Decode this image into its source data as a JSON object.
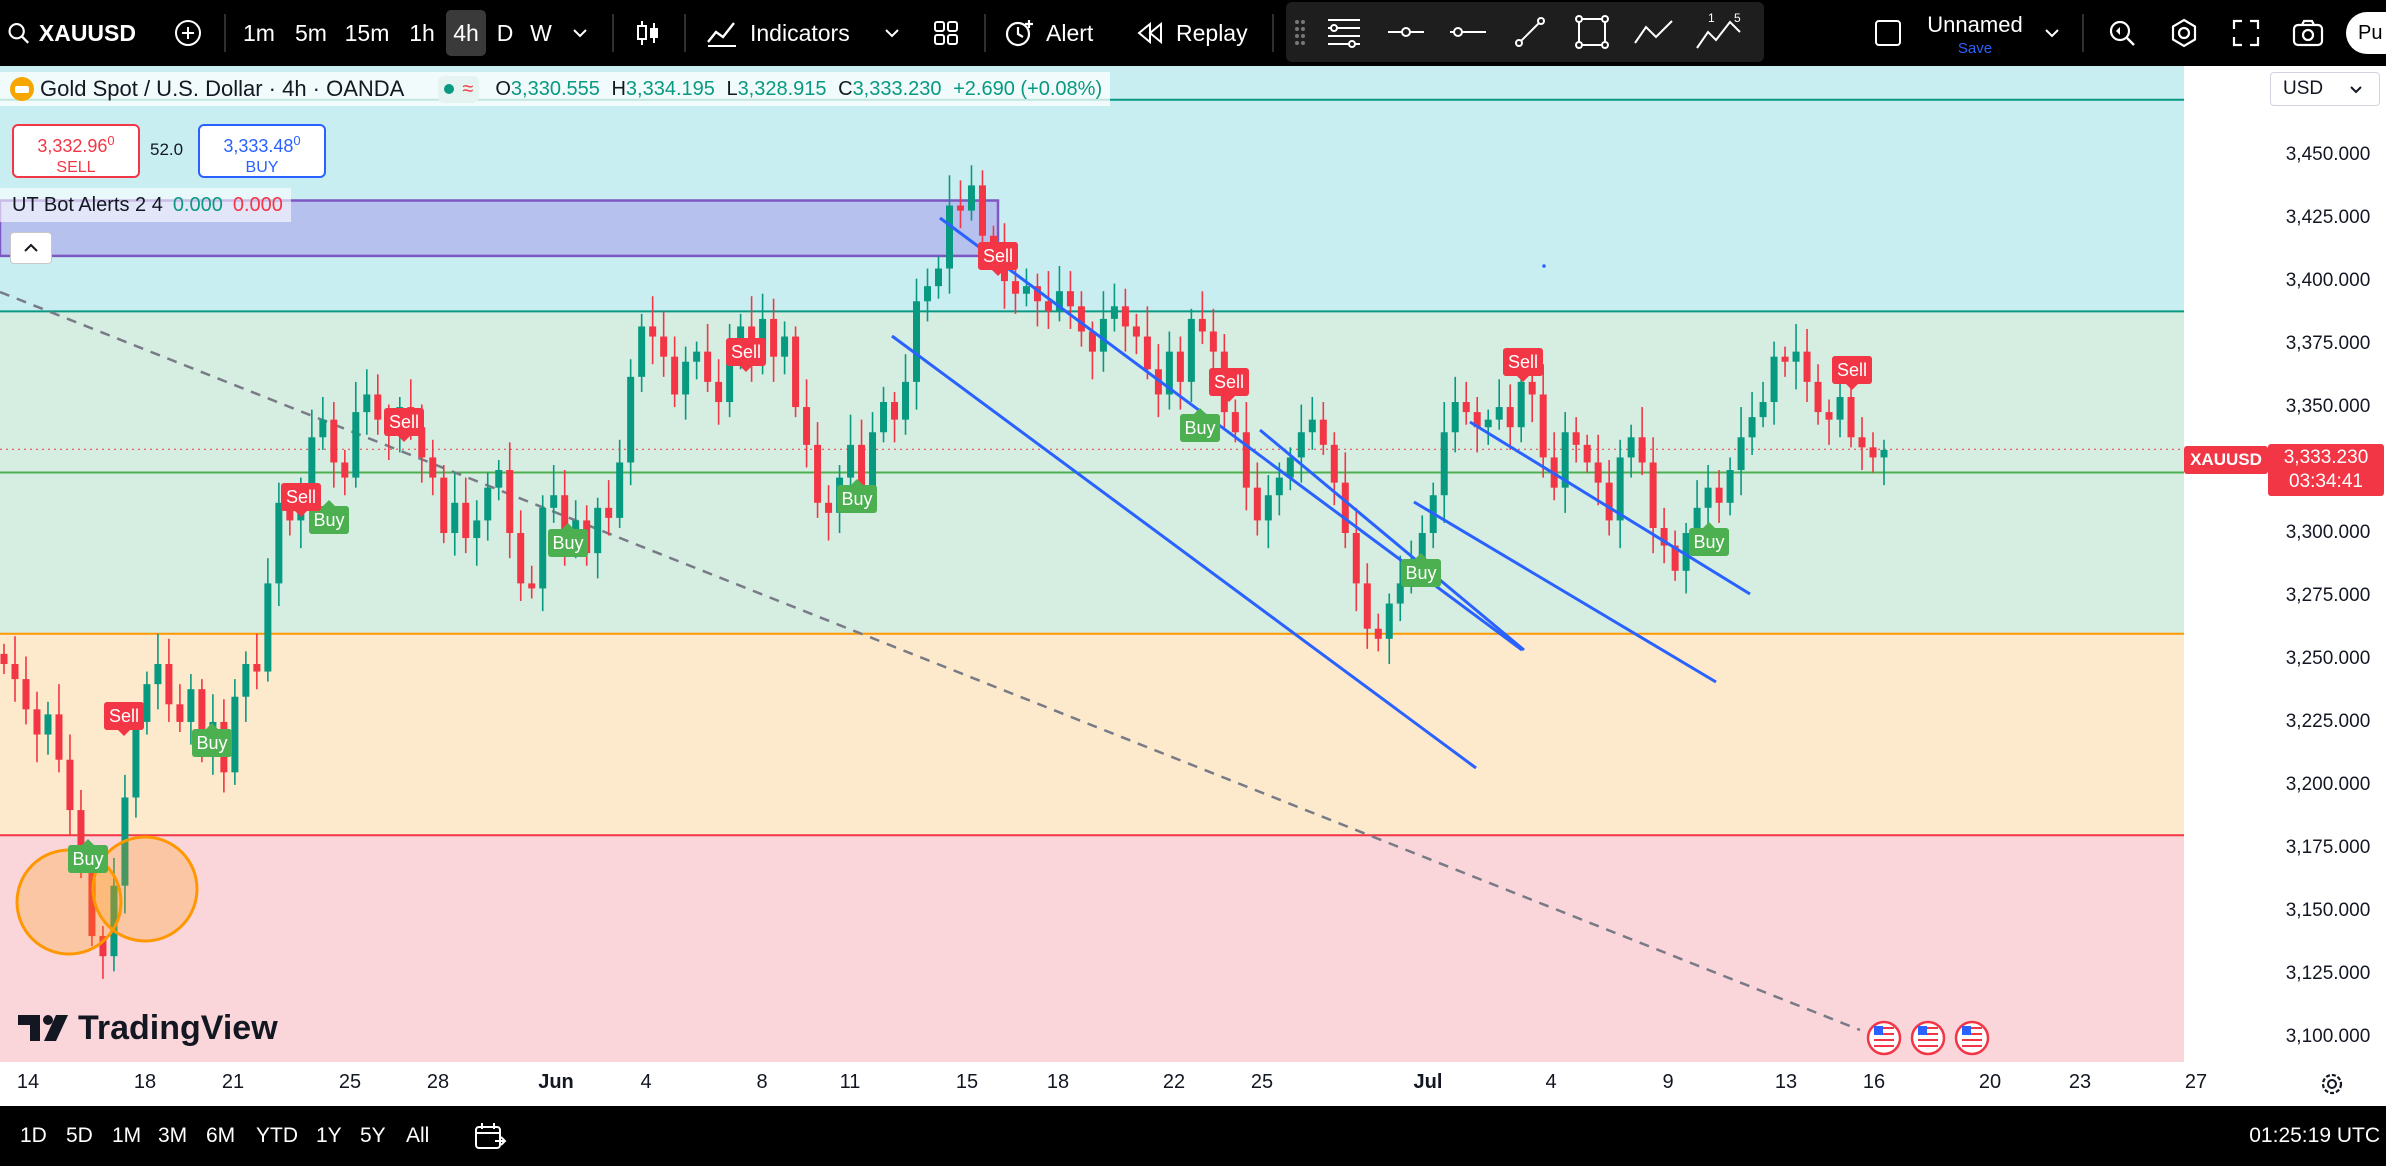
{
  "topbar": {
    "symbol": "XAUUSD",
    "intervals": [
      "1m",
      "5m",
      "15m",
      "1h",
      "4h",
      "D",
      "W"
    ],
    "active_interval": "4h",
    "indicators_label": "Indicators",
    "alert_label": "Alert",
    "replay_label": "Replay",
    "layout_name": "Unnamed",
    "save_label": "Save",
    "publish_label": "Pu",
    "drawing_tool_numbers": [
      "1",
      "5"
    ]
  },
  "legend": {
    "title": "Gold Spot / U.S. Dollar · 4h · OANDA",
    "ohlc": {
      "o_label": "O",
      "o": "3,330.555",
      "h_label": "H",
      "h": "3,334.195",
      "l_label": "L",
      "l": "3,328.915",
      "c_label": "C",
      "c": "3,333.230",
      "change": "+2.690 (+0.08%)"
    }
  },
  "trade": {
    "sell_price": "3,332.96",
    "sell_price_small": "0",
    "sell_label": "SELL",
    "buy_price": "3,333.48",
    "buy_price_small": "0",
    "buy_label": "BUY",
    "spread": "52.0"
  },
  "indicator": {
    "name": "UT Bot Alerts 2 4",
    "v1": "0.000",
    "v2": "0.000"
  },
  "currency": "USD",
  "price_axis": [
    "3,450.000",
    "3,425.000",
    "3,400.000",
    "3,375.000",
    "3,350.000",
    "3,325.000",
    "3,300.000",
    "3,275.000",
    "3,250.000",
    "3,225.000",
    "3,200.000",
    "3,175.000",
    "3,150.000",
    "3,125.000",
    "3,100.000"
  ],
  "current_price": {
    "symbol": "XAUUSD",
    "price": "3,333.230",
    "countdown": "03:34:41"
  },
  "time_axis": [
    "14",
    "18",
    "21",
    "25",
    "28",
    "Jun",
    "4",
    "8",
    "11",
    "15",
    "18",
    "22",
    "25",
    "Jul",
    "4",
    "9",
    "13",
    "16",
    "20",
    "23",
    "27"
  ],
  "signals": {
    "sell": "Sell",
    "buy": "Buy"
  },
  "logo": "TradingView",
  "bottombar": {
    "ranges": [
      "1D",
      "5D",
      "1M",
      "3M",
      "6M",
      "YTD",
      "1Y",
      "5Y",
      "All"
    ],
    "clock": "01:25:19 UTC"
  },
  "colors": {
    "up": "#089981",
    "down": "#f23645",
    "channel": "#2962ff",
    "zone_top": "#c9eef2",
    "zone_mid": "#d6ede2",
    "zone_low": "#fde9cc",
    "zone_bottom": "#fad6db"
  },
  "chart_data": {
    "type": "candlestick",
    "symbol": "XAUUSD",
    "timeframe": "4h",
    "ylim": [
      3090,
      3485
    ],
    "horizontal_levels": [
      3472,
      3388,
      3324,
      3260,
      3180
    ],
    "zone_box": {
      "from_price": 3432,
      "to_price": 3410
    },
    "signals": [
      {
        "type": "Sell",
        "x": "May 17",
        "price": 3222
      },
      {
        "type": "Buy",
        "x": "May 16",
        "price": 3175
      },
      {
        "type": "Buy",
        "x": "May 20",
        "price": 3218
      },
      {
        "type": "Sell",
        "x": "May 23",
        "price": 3325
      },
      {
        "type": "Buy",
        "x": "May 24",
        "price": 3311
      },
      {
        "type": "Sell",
        "x": "May 26",
        "price": 3355
      },
      {
        "type": "Buy",
        "x": "May 30",
        "price": 3302
      },
      {
        "type": "Sell",
        "x": "Jun 6",
        "price": 3380
      },
      {
        "type": "Buy",
        "x": "Jun 9",
        "price": 3322
      },
      {
        "type": "Sell",
        "x": "Jun 16",
        "price": 3407
      },
      {
        "type": "Sell",
        "x": "Jun 23",
        "price": 3357
      },
      {
        "type": "Buy",
        "x": "Jun 22",
        "price": 3343
      },
      {
        "type": "Buy",
        "x": "Jun 29",
        "price": 3285
      },
      {
        "type": "Sell",
        "x": "Jul 3",
        "price": 3375
      },
      {
        "type": "Buy",
        "x": "Jul 10",
        "price": 3303
      },
      {
        "type": "Sell",
        "x": "Jul 14",
        "price": 3371
      }
    ],
    "candles_close": [
      3248,
      3242,
      3230,
      3220,
      3228,
      3210,
      3190,
      3170,
      3140,
      3132,
      3160,
      3195,
      3225,
      3240,
      3248,
      3232,
      3225,
      3238,
      3215,
      3225,
      3205,
      3235,
      3248,
      3245,
      3280,
      3312,
      3305,
      3318,
      3338,
      3345,
      3328,
      3322,
      3348,
      3355,
      3345,
      3340,
      3350,
      3342,
      3330,
      3322,
      3300,
      3312,
      3298,
      3305,
      3318,
      3325,
      3300,
      3280,
      3278,
      3310,
      3315,
      3298,
      3305,
      3292,
      3310,
      3306,
      3328,
      3362,
      3382,
      3378,
      3370,
      3355,
      3368,
      3372,
      3360,
      3352,
      3376,
      3382,
      3368,
      3385,
      3370,
      3378,
      3350,
      3335,
      3312,
      3308,
      3322,
      3335,
      3318,
      3340,
      3352,
      3345,
      3360,
      3392,
      3398,
      3405,
      3430,
      3428,
      3438,
      3418,
      3412,
      3400,
      3395,
      3398,
      3392,
      3388,
      3396,
      3390,
      3380,
      3372,
      3385,
      3390,
      3382,
      3378,
      3365,
      3355,
      3372,
      3360,
      3385,
      3380,
      3372,
      3348,
      3340,
      3318,
      3305,
      3315,
      3322,
      3330,
      3340,
      3345,
      3335,
      3320,
      3300,
      3280,
      3262,
      3258,
      3272,
      3280,
      3288,
      3300,
      3315,
      3340,
      3352,
      3348,
      3342,
      3345,
      3350,
      3342,
      3360,
      3355,
      3330,
      3318,
      3340,
      3335,
      3328,
      3320,
      3305,
      3330,
      3338,
      3328,
      3302,
      3295,
      3285,
      3300,
      3310,
      3318,
      3312,
      3325,
      3338,
      3346,
      3352,
      3370,
      3368,
      3372,
      3360,
      3348,
      3345,
      3354,
      3338,
      3334,
      3330,
      3333
    ]
  }
}
